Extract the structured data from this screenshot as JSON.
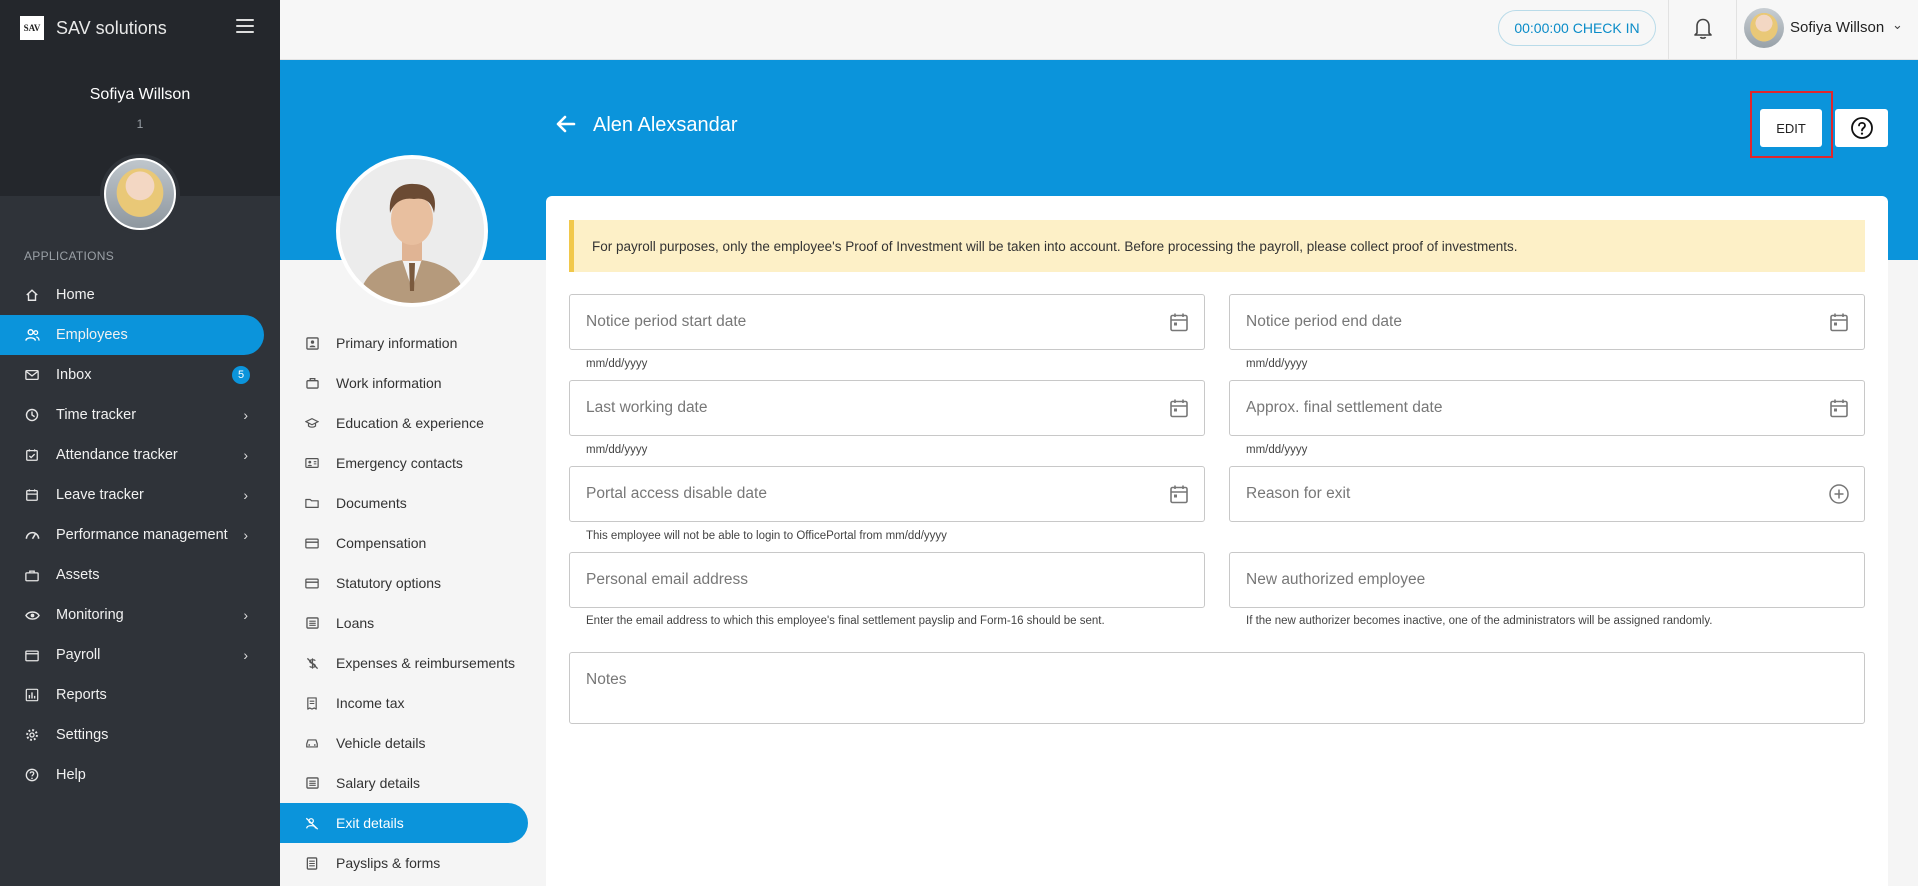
{
  "brand": {
    "logo_text": "SAV",
    "name": "SAV solutions"
  },
  "sidebar": {
    "user_name": "Sofiya Willson",
    "user_id": "1",
    "section_label": "APPLICATIONS",
    "items": [
      {
        "label": "Home",
        "icon": "home-icon"
      },
      {
        "label": "Employees",
        "icon": "people-icon"
      },
      {
        "label": "Inbox",
        "icon": "mail-icon",
        "badge": "5"
      },
      {
        "label": "Time tracker",
        "icon": "clock-icon"
      },
      {
        "label": "Attendance tracker",
        "icon": "calendar-check-icon"
      },
      {
        "label": "Leave tracker",
        "icon": "calendar-icon"
      },
      {
        "label": "Performance management",
        "icon": "gauge-icon"
      },
      {
        "label": "Assets",
        "icon": "briefcase-icon"
      },
      {
        "label": "Monitoring",
        "icon": "eye-icon"
      },
      {
        "label": "Payroll",
        "icon": "wallet-icon"
      },
      {
        "label": "Reports",
        "icon": "chart-icon"
      },
      {
        "label": "Settings",
        "icon": "gear-icon"
      },
      {
        "label": "Help",
        "icon": "help-icon"
      }
    ]
  },
  "topbar": {
    "checkin_label": "00:00:00 CHECK IN",
    "user_name": "Sofiya Willson"
  },
  "header": {
    "title": "Alen Alexsandar",
    "edit_label": "EDIT"
  },
  "profile_nav": {
    "items": [
      {
        "label": "Primary information",
        "icon": "id-card-icon"
      },
      {
        "label": "Work information",
        "icon": "bag-icon"
      },
      {
        "label": "Education & experience",
        "icon": "graduation-cap-icon"
      },
      {
        "label": "Emergency contacts",
        "icon": "contact-card-icon"
      },
      {
        "label": "Documents",
        "icon": "folder-icon"
      },
      {
        "label": "Compensation",
        "icon": "card-icon"
      },
      {
        "label": "Statutory options",
        "icon": "card-icon"
      },
      {
        "label": "Loans",
        "icon": "list-icon"
      },
      {
        "label": "Expenses & reimbursements",
        "icon": "no-money-icon"
      },
      {
        "label": "Income tax",
        "icon": "receipt-icon"
      },
      {
        "label": "Vehicle details",
        "icon": "car-icon"
      },
      {
        "label": "Salary details",
        "icon": "list-icon"
      },
      {
        "label": "Exit details",
        "icon": "person-off-icon"
      },
      {
        "label": "Payslips & forms",
        "icon": "document-icon"
      }
    ]
  },
  "main": {
    "notice": "For payroll purposes, only the employee's Proof of Investment will be taken into account. Before processing the payroll, please collect proof of investments.",
    "fields": {
      "notice_start": {
        "placeholder": "Notice period start date",
        "hint": "mm/dd/yyyy"
      },
      "notice_end": {
        "placeholder": "Notice period end date",
        "hint": "mm/dd/yyyy"
      },
      "last_working": {
        "placeholder": "Last working date",
        "hint": "mm/dd/yyyy"
      },
      "final_settlement": {
        "placeholder": "Approx. final settlement date",
        "hint": "mm/dd/yyyy"
      },
      "portal_disable": {
        "placeholder": "Portal access disable date",
        "hint": "This employee will not be able to login to OfficePortal from mm/dd/yyyy"
      },
      "exit_reason": {
        "placeholder": "Reason for exit"
      },
      "personal_email": {
        "placeholder": "Personal email address",
        "hint": "Enter the email address to which this employee's final settlement payslip and Form-16 should be sent."
      },
      "new_authorized": {
        "placeholder": "New authorized employee",
        "hint": "If the new authorizer becomes inactive, one of the administrators will be assigned randomly."
      },
      "notes": {
        "placeholder": "Notes"
      }
    }
  },
  "colors": {
    "primary": "#0b94db",
    "sidebar_bg": "#2f3339",
    "notice_bg": "#fdf0c7",
    "highlight": "#e0262b"
  }
}
